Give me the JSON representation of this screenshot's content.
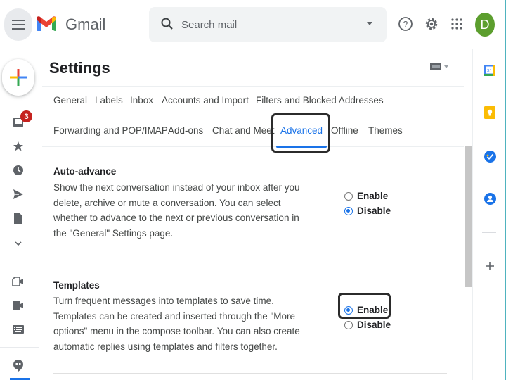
{
  "header": {
    "app_name": "Gmail",
    "search_placeholder": "Search mail",
    "avatar_initial": "D",
    "icons": [
      "menu-icon",
      "gmail-logo",
      "search-icon",
      "search-options-icon",
      "help-icon",
      "settings-icon",
      "apps-icon"
    ]
  },
  "left_rail": {
    "inbox_badge": "3",
    "icons": [
      "compose-icon",
      "inbox-icon",
      "star-icon",
      "snoozed-icon",
      "sent-icon",
      "drafts-icon",
      "more-icon",
      "new-meeting-icon",
      "join-meeting-icon",
      "keyboard-icon",
      "hangouts-icon"
    ]
  },
  "settings": {
    "title": "Settings",
    "tabs_row1": [
      "General",
      "Labels",
      "Inbox",
      "Accounts and Import",
      "Filters and Blocked Addresses"
    ],
    "tabs_row2": [
      "Forwarding and POP/IMAP",
      "Add-ons",
      "Chat and Meet",
      "Advanced",
      "Offline",
      "Themes"
    ],
    "active_tab": "Advanced",
    "sections": [
      {
        "title": "Auto-advance",
        "description": "Show the next conversation instead of your inbox after you delete, archive or mute a conversation. You can select whether to advance to the next or previous conversation in the \"General\" Settings page.",
        "options": [
          "Enable",
          "Disable"
        ],
        "selected": "Disable"
      },
      {
        "title": "Templates",
        "description": "Turn frequent messages into templates to save time. Templates can be created and inserted through the \"More options\" menu in the compose toolbar. You can also create automatic replies using templates and filters together.",
        "options": [
          "Enable",
          "Disable"
        ],
        "selected": "Enable"
      }
    ]
  },
  "right_rail": {
    "icons": [
      "calendar-icon",
      "keep-icon",
      "tasks-icon",
      "contacts-icon",
      "add-addon-icon"
    ],
    "calendar_day": "31"
  },
  "colors": {
    "accent": "#1a73e8",
    "badge": "#c5221f",
    "avatar": "#5c9e2e"
  }
}
